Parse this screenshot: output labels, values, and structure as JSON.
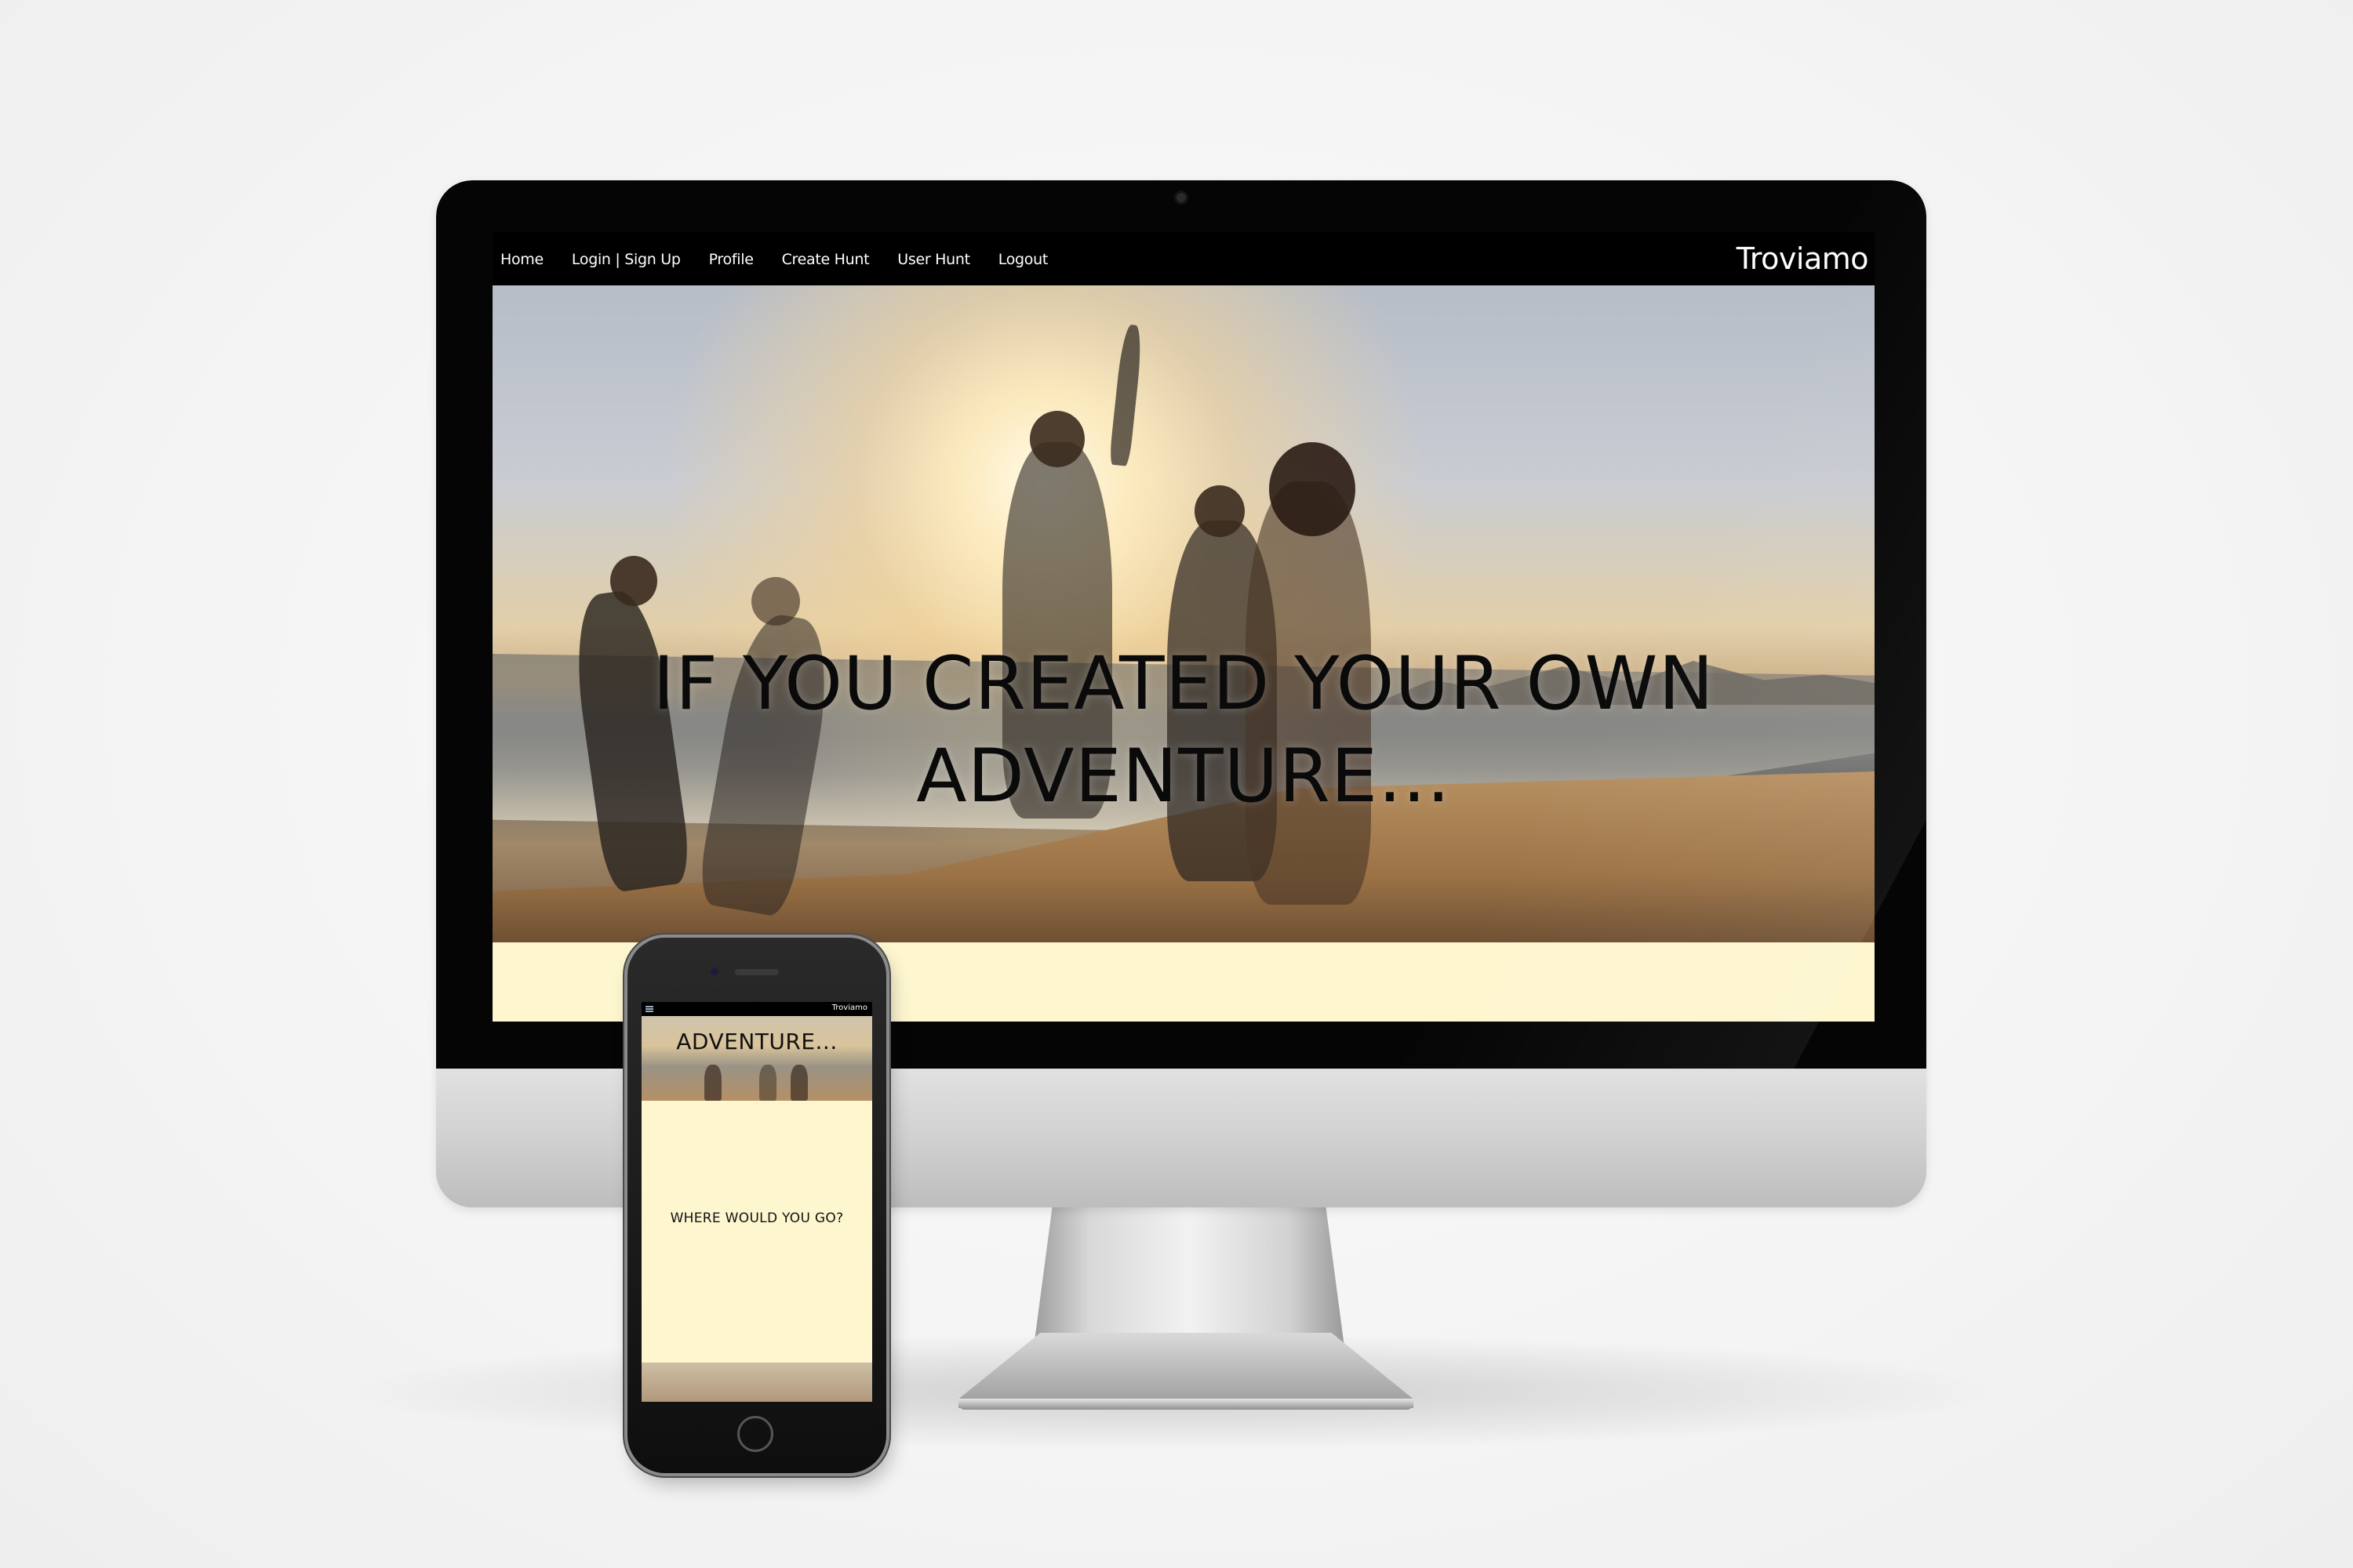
{
  "desktop": {
    "nav": {
      "links": [
        "Home",
        "Login | Sign Up",
        "Profile",
        "Create Hunt",
        "User Hunt",
        "Logout"
      ],
      "brand": "Troviamo"
    },
    "hero": {
      "headline_line1": "IF YOU CREATED YOUR OWN",
      "headline_line2": "ADVENTURE..."
    }
  },
  "mobile": {
    "nav": {
      "brand": "Troviamo"
    },
    "hero": {
      "headline": "ADVENTURE..."
    },
    "question": "WHERE WOULD YOU GO?"
  },
  "colors": {
    "nav_bg": "#000000",
    "content_bg": "#fdf6cf",
    "headline_text": "#0a0a0a"
  }
}
